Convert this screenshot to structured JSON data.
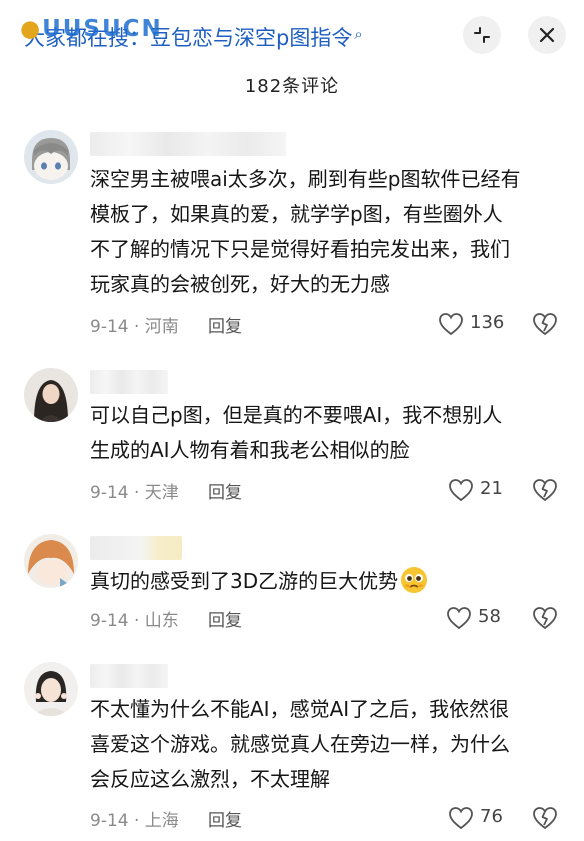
{
  "header": {
    "search_query": "大家都在搜：豆包恋与深空p图指令",
    "watermark": "UUSUCN",
    "shrink_icon": "collapse-icon",
    "close_icon": "close-icon"
  },
  "comment_count": "182条评论",
  "comments": [
    {
      "text": "深空男主被喂ai太多次，刷到有些p图软件已经有\n模板了，如果真的爱，就学学p图，有些圈外人\n不了解的情况下只是觉得好看拍完发出来，我们\n玩家真的会被创死，好大的无力感",
      "date": "9-14 · 河南",
      "reply": "回复",
      "likes": "136"
    },
    {
      "text": "可以自己p图，但是真的不要喂AI，我不想别人\n生成的AI人物有着和我老公相似的脸",
      "date": "9-14 · 天津",
      "reply": "回复",
      "likes": "21"
    },
    {
      "text": "真切的感受到了3D乙游的巨大优势",
      "date": "9-14 · 山东",
      "reply": "回复",
      "likes": "58"
    },
    {
      "text": "不太懂为什么不能AI，感觉AI了之后，我依然很\n喜爱这个游戏。就感觉真人在旁边一样，为什么\n会反应这么激烈，不太理解",
      "date": "9-14 · 上海",
      "reply": "回复",
      "likes": "76"
    }
  ],
  "colors": {
    "search_text": "#1e5fc0",
    "meta_text": "#8a8a8a"
  }
}
